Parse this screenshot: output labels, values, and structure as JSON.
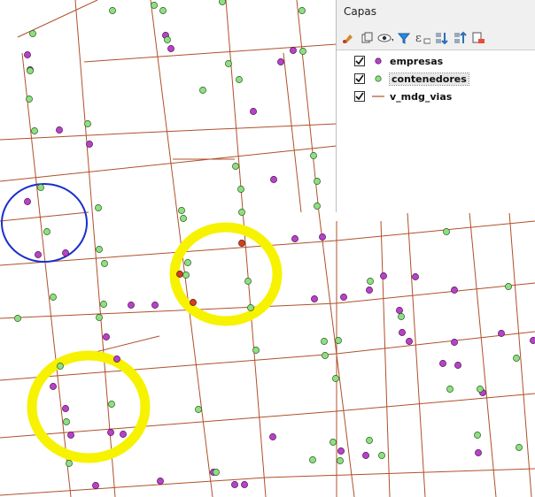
{
  "panel": {
    "title": "Capas",
    "toolbar": [
      "style-layer-icon",
      "add-group-icon",
      "visibility-eye-icon",
      "filter-icon",
      "expression-filter-icon",
      "expand-all-icon",
      "collapse-all-icon",
      "remove-layer-icon"
    ]
  },
  "layers": [
    {
      "name": "empresas",
      "checked": true,
      "symbol": "point",
      "color": "#b941c9"
    },
    {
      "name": "contenedores",
      "checked": true,
      "symbol": "point",
      "color": "#8de07f",
      "selected": true
    },
    {
      "name": "v_mdg_vias",
      "checked": true,
      "symbol": "line",
      "color": "#b0502a"
    }
  ],
  "colors": {
    "road": "#b0502a",
    "empresas": "#b941c9",
    "contenedores": "#8de07f",
    "highlight_red": "#d2401e",
    "annotation_blue": "#1b2fcc",
    "annotation_yellow": "#f7f200"
  }
}
